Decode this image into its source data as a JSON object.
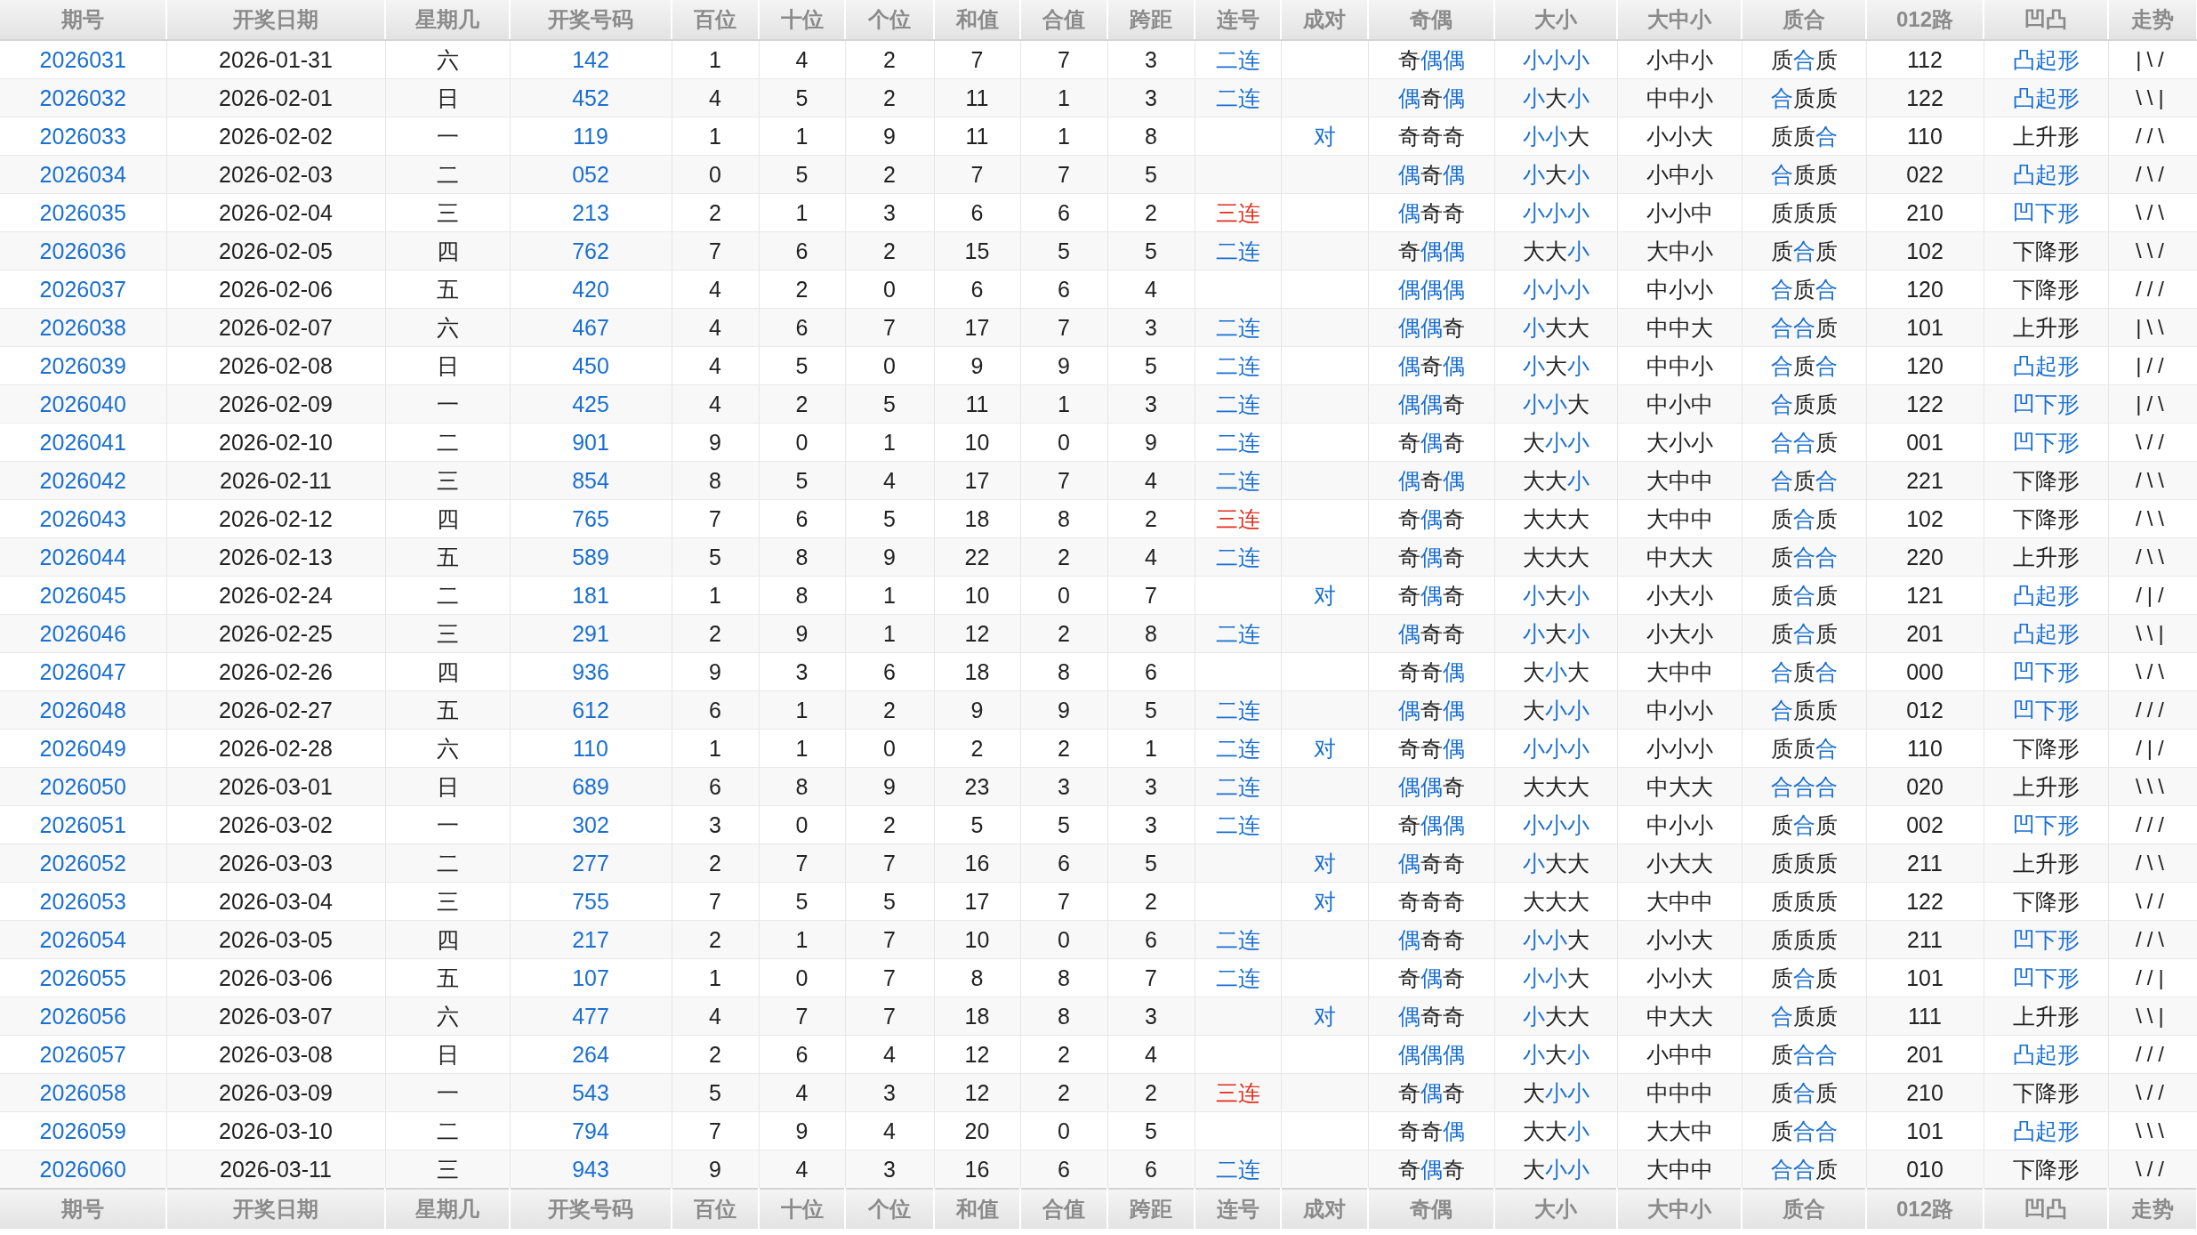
{
  "columns": [
    "期号",
    "开奖日期",
    "星期几",
    "开奖号码",
    "百位",
    "十位",
    "个位",
    "和值",
    "合值",
    "跨距",
    "连号",
    "成对",
    "奇偶",
    "大小",
    "大中小",
    "质合",
    "012路",
    "凹凸",
    "走势"
  ],
  "rows": [
    {
      "issue": "2026031",
      "date": "2026-01-31",
      "weekday": "六",
      "number": "142",
      "hundreds": "1",
      "tens": "4",
      "units": "2",
      "sum": "7",
      "sum_tail": "7",
      "span": "3",
      "consecutive": {
        "text": "二连",
        "color": "#1a6fd1"
      },
      "odd_even": {
        "chars": [
          "奇",
          "偶",
          "偶"
        ],
        "highlighted": [
          false,
          true,
          true
        ]
      },
      "size": {
        "chars": [
          "小",
          "小",
          "小"
        ],
        "highlighted": [
          true,
          true,
          true
        ]
      },
      "big_mid_small": "小中小",
      "prime_composite": {
        "chars": [
          "质",
          "合",
          "质"
        ],
        "highlighted": [
          false,
          true,
          false
        ]
      },
      "route_012": "112",
      "shape": {
        "text": "凸起形",
        "highlighted": true
      },
      "trend": "|\\/"
    },
    {
      "issue": "2026032",
      "date": "2026-02-01",
      "weekday": "日",
      "number": "452",
      "hundreds": "4",
      "tens": "5",
      "units": "2",
      "sum": "11",
      "sum_tail": "1",
      "span": "3",
      "consecutive": {
        "text": "二连",
        "color": "#1a6fd1"
      },
      "odd_even": {
        "chars": [
          "偶",
          "奇",
          "偶"
        ],
        "highlighted": [
          true,
          false,
          true
        ]
      },
      "size": {
        "chars": [
          "小",
          "大",
          "小"
        ],
        "highlighted": [
          true,
          false,
          true
        ]
      },
      "big_mid_small": "中中小",
      "prime_composite": {
        "chars": [
          "合",
          "质",
          "质"
        ],
        "highlighted": [
          true,
          false,
          false
        ]
      },
      "route_012": "122",
      "shape": {
        "text": "凸起形",
        "highlighted": true
      },
      "trend": "\\\\|"
    },
    {
      "issue": "2026033",
      "date": "2026-02-02",
      "weekday": "一",
      "number": "119",
      "hundreds": "1",
      "tens": "1",
      "units": "9",
      "sum": "11",
      "sum_tail": "1",
      "span": "8",
      "pair": "对",
      "odd_even": {
        "chars": [
          "奇",
          "奇",
          "奇"
        ],
        "highlighted": [
          false,
          false,
          false
        ]
      },
      "size": {
        "chars": [
          "小",
          "小",
          "大"
        ],
        "highlighted": [
          true,
          true,
          false
        ]
      },
      "big_mid_small": "小小大",
      "prime_composite": {
        "chars": [
          "质",
          "质",
          "合"
        ],
        "highlighted": [
          false,
          false,
          true
        ]
      },
      "route_012": "110",
      "shape": {
        "text": "上升形",
        "highlighted": false
      },
      "trend": "//\\"
    },
    {
      "issue": "2026034",
      "date": "2026-02-03",
      "weekday": "二",
      "number": "052",
      "hundreds": "0",
      "tens": "5",
      "units": "2",
      "sum": "7",
      "sum_tail": "7",
      "span": "5",
      "odd_even": {
        "chars": [
          "偶",
          "奇",
          "偶"
        ],
        "highlighted": [
          true,
          false,
          true
        ]
      },
      "size": {
        "chars": [
          "小",
          "大",
          "小"
        ],
        "highlighted": [
          true,
          false,
          true
        ]
      },
      "big_mid_small": "小中小",
      "prime_composite": {
        "chars": [
          "合",
          "质",
          "质"
        ],
        "highlighted": [
          true,
          false,
          false
        ]
      },
      "route_012": "022",
      "shape": {
        "text": "凸起形",
        "highlighted": true
      },
      "trend": "/\\/"
    },
    {
      "issue": "2026035",
      "date": "2026-02-04",
      "weekday": "三",
      "number": "213",
      "hundreds": "2",
      "tens": "1",
      "units": "3",
      "sum": "6",
      "sum_tail": "6",
      "span": "2",
      "consecutive": {
        "text": "三连",
        "color": "#e0301e"
      },
      "odd_even": {
        "chars": [
          "偶",
          "奇",
          "奇"
        ],
        "highlighted": [
          true,
          false,
          false
        ]
      },
      "size": {
        "chars": [
          "小",
          "小",
          "小"
        ],
        "highlighted": [
          true,
          true,
          true
        ]
      },
      "big_mid_small": "小小中",
      "prime_composite": {
        "chars": [
          "质",
          "质",
          "质"
        ],
        "highlighted": [
          false,
          false,
          false
        ]
      },
      "route_012": "210",
      "shape": {
        "text": "凹下形",
        "highlighted": true
      },
      "trend": "\\/\\"
    },
    {
      "issue": "2026036",
      "date": "2026-02-05",
      "weekday": "四",
      "number": "762",
      "hundreds": "7",
      "tens": "6",
      "units": "2",
      "sum": "15",
      "sum_tail": "5",
      "span": "5",
      "consecutive": {
        "text": "二连",
        "color": "#1a6fd1"
      },
      "odd_even": {
        "chars": [
          "奇",
          "偶",
          "偶"
        ],
        "highlighted": [
          false,
          true,
          true
        ]
      },
      "size": {
        "chars": [
          "大",
          "大",
          "小"
        ],
        "highlighted": [
          false,
          false,
          true
        ]
      },
      "big_mid_small": "大中小",
      "prime_composite": {
        "chars": [
          "质",
          "合",
          "质"
        ],
        "highlighted": [
          false,
          true,
          false
        ]
      },
      "route_012": "102",
      "shape": {
        "text": "下降形",
        "highlighted": false
      },
      "trend": "\\\\/"
    },
    {
      "issue": "2026037",
      "date": "2026-02-06",
      "weekday": "五",
      "number": "420",
      "hundreds": "4",
      "tens": "2",
      "units": "0",
      "sum": "6",
      "sum_tail": "6",
      "span": "4",
      "odd_even": {
        "chars": [
          "偶",
          "偶",
          "偶"
        ],
        "highlighted": [
          true,
          true,
          true
        ]
      },
      "size": {
        "chars": [
          "小",
          "小",
          "小"
        ],
        "highlighted": [
          true,
          true,
          true
        ]
      },
      "big_mid_small": "中小小",
      "prime_composite": {
        "chars": [
          "合",
          "质",
          "合"
        ],
        "highlighted": [
          true,
          false,
          true
        ]
      },
      "route_012": "120",
      "shape": {
        "text": "下降形",
        "highlighted": false
      },
      "trend": "///"
    },
    {
      "issue": "2026038",
      "date": "2026-02-07",
      "weekday": "六",
      "number": "467",
      "hundreds": "4",
      "tens": "6",
      "units": "7",
      "sum": "17",
      "sum_tail": "7",
      "span": "3",
      "consecutive": {
        "text": "二连",
        "color": "#1a6fd1"
      },
      "odd_even": {
        "chars": [
          "偶",
          "偶",
          "奇"
        ],
        "highlighted": [
          true,
          true,
          false
        ]
      },
      "size": {
        "chars": [
          "小",
          "大",
          "大"
        ],
        "highlighted": [
          true,
          false,
          false
        ]
      },
      "big_mid_small": "中中大",
      "prime_composite": {
        "chars": [
          "合",
          "合",
          "质"
        ],
        "highlighted": [
          true,
          true,
          false
        ]
      },
      "route_012": "101",
      "shape": {
        "text": "上升形",
        "highlighted": false
      },
      "trend": "|\\\\"
    },
    {
      "issue": "2026039",
      "date": "2026-02-08",
      "weekday": "日",
      "number": "450",
      "hundreds": "4",
      "tens": "5",
      "units": "0",
      "sum": "9",
      "sum_tail": "9",
      "span": "5",
      "consecutive": {
        "text": "二连",
        "color": "#1a6fd1"
      },
      "odd_even": {
        "chars": [
          "偶",
          "奇",
          "偶"
        ],
        "highlighted": [
          true,
          false,
          true
        ]
      },
      "size": {
        "chars": [
          "小",
          "大",
          "小"
        ],
        "highlighted": [
          true,
          false,
          true
        ]
      },
      "big_mid_small": "中中小",
      "prime_composite": {
        "chars": [
          "合",
          "质",
          "合"
        ],
        "highlighted": [
          true,
          false,
          true
        ]
      },
      "route_012": "120",
      "shape": {
        "text": "凸起形",
        "highlighted": true
      },
      "trend": "|//"
    },
    {
      "issue": "2026040",
      "date": "2026-02-09",
      "weekday": "一",
      "number": "425",
      "hundreds": "4",
      "tens": "2",
      "units": "5",
      "sum": "11",
      "sum_tail": "1",
      "span": "3",
      "consecutive": {
        "text": "二连",
        "color": "#1a6fd1"
      },
      "odd_even": {
        "chars": [
          "偶",
          "偶",
          "奇"
        ],
        "highlighted": [
          true,
          true,
          false
        ]
      },
      "size": {
        "chars": [
          "小",
          "小",
          "大"
        ],
        "highlighted": [
          true,
          true,
          false
        ]
      },
      "big_mid_small": "中小中",
      "prime_composite": {
        "chars": [
          "合",
          "质",
          "质"
        ],
        "highlighted": [
          true,
          false,
          false
        ]
      },
      "route_012": "122",
      "shape": {
        "text": "凹下形",
        "highlighted": true
      },
      "trend": "|/\\"
    },
    {
      "issue": "2026041",
      "date": "2026-02-10",
      "weekday": "二",
      "number": "901",
      "hundreds": "9",
      "tens": "0",
      "units": "1",
      "sum": "10",
      "sum_tail": "0",
      "span": "9",
      "consecutive": {
        "text": "二连",
        "color": "#1a6fd1"
      },
      "odd_even": {
        "chars": [
          "奇",
          "偶",
          "奇"
        ],
        "highlighted": [
          false,
          true,
          false
        ]
      },
      "size": {
        "chars": [
          "大",
          "小",
          "小"
        ],
        "highlighted": [
          false,
          true,
          true
        ]
      },
      "big_mid_small": "大小小",
      "prime_composite": {
        "chars": [
          "合",
          "合",
          "质"
        ],
        "highlighted": [
          true,
          true,
          false
        ]
      },
      "route_012": "001",
      "shape": {
        "text": "凹下形",
        "highlighted": true
      },
      "trend": "\\//"
    },
    {
      "issue": "2026042",
      "date": "2026-02-11",
      "weekday": "三",
      "number": "854",
      "hundreds": "8",
      "tens": "5",
      "units": "4",
      "sum": "17",
      "sum_tail": "7",
      "span": "4",
      "consecutive": {
        "text": "二连",
        "color": "#1a6fd1"
      },
      "odd_even": {
        "chars": [
          "偶",
          "奇",
          "偶"
        ],
        "highlighted": [
          true,
          false,
          true
        ]
      },
      "size": {
        "chars": [
          "大",
          "大",
          "小"
        ],
        "highlighted": [
          false,
          false,
          true
        ]
      },
      "big_mid_small": "大中中",
      "prime_composite": {
        "chars": [
          "合",
          "质",
          "合"
        ],
        "highlighted": [
          true,
          false,
          true
        ]
      },
      "route_012": "221",
      "shape": {
        "text": "下降形",
        "highlighted": false
      },
      "trend": "/\\\\"
    },
    {
      "issue": "2026043",
      "date": "2026-02-12",
      "weekday": "四",
      "number": "765",
      "hundreds": "7",
      "tens": "6",
      "units": "5",
      "sum": "18",
      "sum_tail": "8",
      "span": "2",
      "consecutive": {
        "text": "三连",
        "color": "#e0301e"
      },
      "odd_even": {
        "chars": [
          "奇",
          "偶",
          "奇"
        ],
        "highlighted": [
          false,
          true,
          false
        ]
      },
      "size": {
        "chars": [
          "大",
          "大",
          "大"
        ],
        "highlighted": [
          false,
          false,
          false
        ]
      },
      "big_mid_small": "大中中",
      "prime_composite": {
        "chars": [
          "质",
          "合",
          "质"
        ],
        "highlighted": [
          false,
          true,
          false
        ]
      },
      "route_012": "102",
      "shape": {
        "text": "下降形",
        "highlighted": false
      },
      "trend": "/\\\\"
    },
    {
      "issue": "2026044",
      "date": "2026-02-13",
      "weekday": "五",
      "number": "589",
      "hundreds": "5",
      "tens": "8",
      "units": "9",
      "sum": "22",
      "sum_tail": "2",
      "span": "4",
      "consecutive": {
        "text": "二连",
        "color": "#1a6fd1"
      },
      "odd_even": {
        "chars": [
          "奇",
          "偶",
          "奇"
        ],
        "highlighted": [
          false,
          true,
          false
        ]
      },
      "size": {
        "chars": [
          "大",
          "大",
          "大"
        ],
        "highlighted": [
          false,
          false,
          false
        ]
      },
      "big_mid_small": "中大大",
      "prime_composite": {
        "chars": [
          "质",
          "合",
          "合"
        ],
        "highlighted": [
          false,
          true,
          true
        ]
      },
      "route_012": "220",
      "shape": {
        "text": "上升形",
        "highlighted": false
      },
      "trend": "/\\\\"
    },
    {
      "issue": "2026045",
      "date": "2026-02-24",
      "weekday": "二",
      "number": "181",
      "hundreds": "1",
      "tens": "8",
      "units": "1",
      "sum": "10",
      "sum_tail": "0",
      "span": "7",
      "pair": "对",
      "odd_even": {
        "chars": [
          "奇",
          "偶",
          "奇"
        ],
        "highlighted": [
          false,
          true,
          false
        ]
      },
      "size": {
        "chars": [
          "小",
          "大",
          "小"
        ],
        "highlighted": [
          true,
          false,
          true
        ]
      },
      "big_mid_small": "小大小",
      "prime_composite": {
        "chars": [
          "质",
          "合",
          "质"
        ],
        "highlighted": [
          false,
          true,
          false
        ]
      },
      "route_012": "121",
      "shape": {
        "text": "凸起形",
        "highlighted": true
      },
      "trend": "/|/"
    },
    {
      "issue": "2026046",
      "date": "2026-02-25",
      "weekday": "三",
      "number": "291",
      "hundreds": "2",
      "tens": "9",
      "units": "1",
      "sum": "12",
      "sum_tail": "2",
      "span": "8",
      "consecutive": {
        "text": "二连",
        "color": "#1a6fd1"
      },
      "odd_even": {
        "chars": [
          "偶",
          "奇",
          "奇"
        ],
        "highlighted": [
          true,
          false,
          false
        ]
      },
      "size": {
        "chars": [
          "小",
          "大",
          "小"
        ],
        "highlighted": [
          true,
          false,
          true
        ]
      },
      "big_mid_small": "小大小",
      "prime_composite": {
        "chars": [
          "质",
          "合",
          "质"
        ],
        "highlighted": [
          false,
          true,
          false
        ]
      },
      "route_012": "201",
      "shape": {
        "text": "凸起形",
        "highlighted": true
      },
      "trend": "\\\\|"
    },
    {
      "issue": "2026047",
      "date": "2026-02-26",
      "weekday": "四",
      "number": "936",
      "hundreds": "9",
      "tens": "3",
      "units": "6",
      "sum": "18",
      "sum_tail": "8",
      "span": "6",
      "odd_even": {
        "chars": [
          "奇",
          "奇",
          "偶"
        ],
        "highlighted": [
          false,
          false,
          true
        ]
      },
      "size": {
        "chars": [
          "大",
          "小",
          "大"
        ],
        "highlighted": [
          false,
          true,
          false
        ]
      },
      "big_mid_small": "大中中",
      "prime_composite": {
        "chars": [
          "合",
          "质",
          "合"
        ],
        "highlighted": [
          true,
          false,
          true
        ]
      },
      "route_012": "000",
      "shape": {
        "text": "凹下形",
        "highlighted": true
      },
      "trend": "\\/\\"
    },
    {
      "issue": "2026048",
      "date": "2026-02-27",
      "weekday": "五",
      "number": "612",
      "hundreds": "6",
      "tens": "1",
      "units": "2",
      "sum": "9",
      "sum_tail": "9",
      "span": "5",
      "consecutive": {
        "text": "二连",
        "color": "#1a6fd1"
      },
      "odd_even": {
        "chars": [
          "偶",
          "奇",
          "偶"
        ],
        "highlighted": [
          true,
          false,
          true
        ]
      },
      "size": {
        "chars": [
          "大",
          "小",
          "小"
        ],
        "highlighted": [
          false,
          true,
          true
        ]
      },
      "big_mid_small": "中小小",
      "prime_composite": {
        "chars": [
          "合",
          "质",
          "质"
        ],
        "highlighted": [
          true,
          false,
          false
        ]
      },
      "route_012": "012",
      "shape": {
        "text": "凹下形",
        "highlighted": true
      },
      "trend": "///"
    },
    {
      "issue": "2026049",
      "date": "2026-02-28",
      "weekday": "六",
      "number": "110",
      "hundreds": "1",
      "tens": "1",
      "units": "0",
      "sum": "2",
      "sum_tail": "2",
      "span": "1",
      "consecutive": {
        "text": "二连",
        "color": "#1a6fd1"
      },
      "pair": "对",
      "odd_even": {
        "chars": [
          "奇",
          "奇",
          "偶"
        ],
        "highlighted": [
          false,
          false,
          true
        ]
      },
      "size": {
        "chars": [
          "小",
          "小",
          "小"
        ],
        "highlighted": [
          true,
          true,
          true
        ]
      },
      "big_mid_small": "小小小",
      "prime_composite": {
        "chars": [
          "质",
          "质",
          "合"
        ],
        "highlighted": [
          false,
          false,
          true
        ]
      },
      "route_012": "110",
      "shape": {
        "text": "下降形",
        "highlighted": false
      },
      "trend": "/|/"
    },
    {
      "issue": "2026050",
      "date": "2026-03-01",
      "weekday": "日",
      "number": "689",
      "hundreds": "6",
      "tens": "8",
      "units": "9",
      "sum": "23",
      "sum_tail": "3",
      "span": "3",
      "consecutive": {
        "text": "二连",
        "color": "#1a6fd1"
      },
      "odd_even": {
        "chars": [
          "偶",
          "偶",
          "奇"
        ],
        "highlighted": [
          true,
          true,
          false
        ]
      },
      "size": {
        "chars": [
          "大",
          "大",
          "大"
        ],
        "highlighted": [
          false,
          false,
          false
        ]
      },
      "big_mid_small": "中大大",
      "prime_composite": {
        "chars": [
          "合",
          "合",
          "合"
        ],
        "highlighted": [
          true,
          true,
          true
        ]
      },
      "route_012": "020",
      "shape": {
        "text": "上升形",
        "highlighted": false
      },
      "trend": "\\\\\\"
    },
    {
      "issue": "2026051",
      "date": "2026-03-02",
      "weekday": "一",
      "number": "302",
      "hundreds": "3",
      "tens": "0",
      "units": "2",
      "sum": "5",
      "sum_tail": "5",
      "span": "3",
      "consecutive": {
        "text": "二连",
        "color": "#1a6fd1"
      },
      "odd_even": {
        "chars": [
          "奇",
          "偶",
          "偶"
        ],
        "highlighted": [
          false,
          true,
          true
        ]
      },
      "size": {
        "chars": [
          "小",
          "小",
          "小"
        ],
        "highlighted": [
          true,
          true,
          true
        ]
      },
      "big_mid_small": "中小小",
      "prime_composite": {
        "chars": [
          "质",
          "合",
          "质"
        ],
        "highlighted": [
          false,
          true,
          false
        ]
      },
      "route_012": "002",
      "shape": {
        "text": "凹下形",
        "highlighted": true
      },
      "trend": "///"
    },
    {
      "issue": "2026052",
      "date": "2026-03-03",
      "weekday": "二",
      "number": "277",
      "hundreds": "2",
      "tens": "7",
      "units": "7",
      "sum": "16",
      "sum_tail": "6",
      "span": "5",
      "pair": "对",
      "odd_even": {
        "chars": [
          "偶",
          "奇",
          "奇"
        ],
        "highlighted": [
          true,
          false,
          false
        ]
      },
      "size": {
        "chars": [
          "小",
          "大",
          "大"
        ],
        "highlighted": [
          true,
          false,
          false
        ]
      },
      "big_mid_small": "小大大",
      "prime_composite": {
        "chars": [
          "质",
          "质",
          "质"
        ],
        "highlighted": [
          false,
          false,
          false
        ]
      },
      "route_012": "211",
      "shape": {
        "text": "上升形",
        "highlighted": false
      },
      "trend": "/\\\\"
    },
    {
      "issue": "2026053",
      "date": "2026-03-04",
      "weekday": "三",
      "number": "755",
      "hundreds": "7",
      "tens": "5",
      "units": "5",
      "sum": "17",
      "sum_tail": "7",
      "span": "2",
      "pair": "对",
      "odd_even": {
        "chars": [
          "奇",
          "奇",
          "奇"
        ],
        "highlighted": [
          false,
          false,
          false
        ]
      },
      "size": {
        "chars": [
          "大",
          "大",
          "大"
        ],
        "highlighted": [
          false,
          false,
          false
        ]
      },
      "big_mid_small": "大中中",
      "prime_composite": {
        "chars": [
          "质",
          "质",
          "质"
        ],
        "highlighted": [
          false,
          false,
          false
        ]
      },
      "route_012": "122",
      "shape": {
        "text": "下降形",
        "highlighted": false
      },
      "trend": "\\//"
    },
    {
      "issue": "2026054",
      "date": "2026-03-05",
      "weekday": "四",
      "number": "217",
      "hundreds": "2",
      "tens": "1",
      "units": "7",
      "sum": "10",
      "sum_tail": "0",
      "span": "6",
      "consecutive": {
        "text": "二连",
        "color": "#1a6fd1"
      },
      "odd_even": {
        "chars": [
          "偶",
          "奇",
          "奇"
        ],
        "highlighted": [
          true,
          false,
          false
        ]
      },
      "size": {
        "chars": [
          "小",
          "小",
          "大"
        ],
        "highlighted": [
          true,
          true,
          false
        ]
      },
      "big_mid_small": "小小大",
      "prime_composite": {
        "chars": [
          "质",
          "质",
          "质"
        ],
        "highlighted": [
          false,
          false,
          false
        ]
      },
      "route_012": "211",
      "shape": {
        "text": "凹下形",
        "highlighted": true
      },
      "trend": "//\\"
    },
    {
      "issue": "2026055",
      "date": "2026-03-06",
      "weekday": "五",
      "number": "107",
      "hundreds": "1",
      "tens": "0",
      "units": "7",
      "sum": "8",
      "sum_tail": "8",
      "span": "7",
      "consecutive": {
        "text": "二连",
        "color": "#1a6fd1"
      },
      "odd_even": {
        "chars": [
          "奇",
          "偶",
          "奇"
        ],
        "highlighted": [
          false,
          true,
          false
        ]
      },
      "size": {
        "chars": [
          "小",
          "小",
          "大"
        ],
        "highlighted": [
          true,
          true,
          false
        ]
      },
      "big_mid_small": "小小大",
      "prime_composite": {
        "chars": [
          "质",
          "合",
          "质"
        ],
        "highlighted": [
          false,
          true,
          false
        ]
      },
      "route_012": "101",
      "shape": {
        "text": "凹下形",
        "highlighted": true
      },
      "trend": "//|"
    },
    {
      "issue": "2026056",
      "date": "2026-03-07",
      "weekday": "六",
      "number": "477",
      "hundreds": "4",
      "tens": "7",
      "units": "7",
      "sum": "18",
      "sum_tail": "8",
      "span": "3",
      "pair": "对",
      "odd_even": {
        "chars": [
          "偶",
          "奇",
          "奇"
        ],
        "highlighted": [
          true,
          false,
          false
        ]
      },
      "size": {
        "chars": [
          "小",
          "大",
          "大"
        ],
        "highlighted": [
          true,
          false,
          false
        ]
      },
      "big_mid_small": "中大大",
      "prime_composite": {
        "chars": [
          "合",
          "质",
          "质"
        ],
        "highlighted": [
          true,
          false,
          false
        ]
      },
      "route_012": "111",
      "shape": {
        "text": "上升形",
        "highlighted": false
      },
      "trend": "\\\\|"
    },
    {
      "issue": "2026057",
      "date": "2026-03-08",
      "weekday": "日",
      "number": "264",
      "hundreds": "2",
      "tens": "6",
      "units": "4",
      "sum": "12",
      "sum_tail": "2",
      "span": "4",
      "odd_even": {
        "chars": [
          "偶",
          "偶",
          "偶"
        ],
        "highlighted": [
          true,
          true,
          true
        ]
      },
      "size": {
        "chars": [
          "小",
          "大",
          "小"
        ],
        "highlighted": [
          true,
          false,
          true
        ]
      },
      "big_mid_small": "小中中",
      "prime_composite": {
        "chars": [
          "质",
          "合",
          "合"
        ],
        "highlighted": [
          false,
          true,
          true
        ]
      },
      "route_012": "201",
      "shape": {
        "text": "凸起形",
        "highlighted": true
      },
      "trend": "///"
    },
    {
      "issue": "2026058",
      "date": "2026-03-09",
      "weekday": "一",
      "number": "543",
      "hundreds": "5",
      "tens": "4",
      "units": "3",
      "sum": "12",
      "sum_tail": "2",
      "span": "2",
      "consecutive": {
        "text": "三连",
        "color": "#e0301e"
      },
      "odd_even": {
        "chars": [
          "奇",
          "偶",
          "奇"
        ],
        "highlighted": [
          false,
          true,
          false
        ]
      },
      "size": {
        "chars": [
          "大",
          "小",
          "小"
        ],
        "highlighted": [
          false,
          true,
          true
        ]
      },
      "big_mid_small": "中中中",
      "prime_composite": {
        "chars": [
          "质",
          "合",
          "质"
        ],
        "highlighted": [
          false,
          true,
          false
        ]
      },
      "route_012": "210",
      "shape": {
        "text": "下降形",
        "highlighted": false
      },
      "trend": "\\//"
    },
    {
      "issue": "2026059",
      "date": "2026-03-10",
      "weekday": "二",
      "number": "794",
      "hundreds": "7",
      "tens": "9",
      "units": "4",
      "sum": "20",
      "sum_tail": "0",
      "span": "5",
      "odd_even": {
        "chars": [
          "奇",
          "奇",
          "偶"
        ],
        "highlighted": [
          false,
          false,
          true
        ]
      },
      "size": {
        "chars": [
          "大",
          "大",
          "小"
        ],
        "highlighted": [
          false,
          false,
          true
        ]
      },
      "big_mid_small": "大大中",
      "prime_composite": {
        "chars": [
          "质",
          "合",
          "合"
        ],
        "highlighted": [
          false,
          true,
          true
        ]
      },
      "route_012": "101",
      "shape": {
        "text": "凸起形",
        "highlighted": true
      },
      "trend": "\\\\\\"
    },
    {
      "issue": "2026060",
      "date": "2026-03-11",
      "weekday": "三",
      "number": "943",
      "hundreds": "9",
      "tens": "4",
      "units": "3",
      "sum": "16",
      "sum_tail": "6",
      "span": "6",
      "consecutive": {
        "text": "二连",
        "color": "#1a6fd1"
      },
      "odd_even": {
        "chars": [
          "奇",
          "偶",
          "奇"
        ],
        "highlighted": [
          false,
          true,
          false
        ]
      },
      "size": {
        "chars": [
          "大",
          "小",
          "小"
        ],
        "highlighted": [
          false,
          true,
          true
        ]
      },
      "big_mid_small": "大中中",
      "prime_composite": {
        "chars": [
          "合",
          "合",
          "质"
        ],
        "highlighted": [
          true,
          true,
          false
        ]
      },
      "route_012": "010",
      "shape": {
        "text": "下降形",
        "highlighted": false
      },
      "trend": "\\//"
    }
  ],
  "footer_columns": [
    "期号",
    "开奖日期",
    "星期几",
    "开奖号码",
    "百位",
    "十位",
    "个位",
    "和值",
    "合值",
    "跨距",
    "连号",
    "成对",
    "奇偶",
    "大小",
    "大中小",
    "质合",
    "012路",
    "凹凸",
    "走势"
  ]
}
